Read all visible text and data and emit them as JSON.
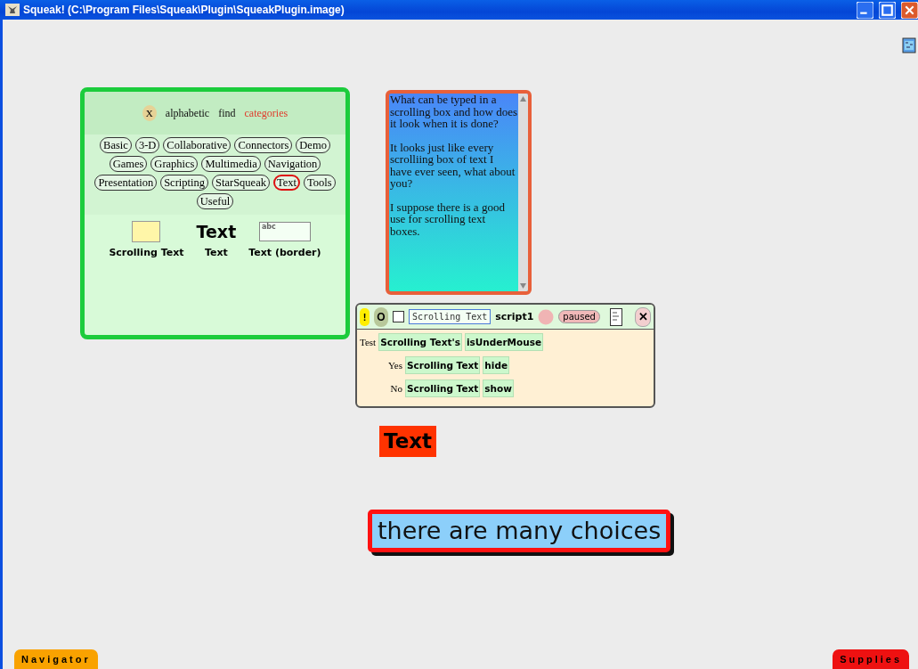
{
  "window": {
    "title": "Squeak! (C:\\Program Files\\Squeak\\Plugin\\SqueakPlugin.image)"
  },
  "parts_bin": {
    "close": "X",
    "tabs": [
      {
        "label": "alphabetic",
        "selected": false
      },
      {
        "label": "find",
        "selected": false
      },
      {
        "label": "categories",
        "selected": true
      }
    ],
    "categories": [
      {
        "label": "Basic",
        "selected": false
      },
      {
        "label": "3-D",
        "selected": false
      },
      {
        "label": "Collaborative",
        "selected": false
      },
      {
        "label": "Connectors",
        "selected": false
      },
      {
        "label": "Demo",
        "selected": false
      },
      {
        "label": "Games",
        "selected": false
      },
      {
        "label": "Graphics",
        "selected": false
      },
      {
        "label": "Multimedia",
        "selected": false
      },
      {
        "label": "Navigation",
        "selected": false
      },
      {
        "label": "Presentation",
        "selected": false
      },
      {
        "label": "Scripting",
        "selected": false
      },
      {
        "label": "StarSqueak",
        "selected": false
      },
      {
        "label": "Text",
        "selected": true
      },
      {
        "label": "Tools",
        "selected": false
      },
      {
        "label": "Useful",
        "selected": false
      }
    ],
    "items": [
      {
        "kind": "scrolling",
        "label": "Scrolling Text"
      },
      {
        "kind": "text",
        "sample": "Text",
        "label": "Text"
      },
      {
        "kind": "bordered",
        "sample": "abc",
        "label": "Text (border)"
      }
    ]
  },
  "scrolling_text": {
    "paragraphs": [
      "What can be typed in a scrolling box and how does it look when it is done?",
      "It looks just like every scrolliing box of text I have ever seen, what about you?",
      "I suppose there is a good use for scrolling text boxes."
    ]
  },
  "script": {
    "bang": "!",
    "ticker": "O",
    "checked": false,
    "object": "Scrolling Text",
    "name": "script1",
    "status": "paused",
    "close": "✕",
    "rows": [
      {
        "label": "Test",
        "tiles": [
          "Scrolling Text's",
          "isUnderMouse"
        ]
      },
      {
        "label": "Yes",
        "tiles": [
          "Scrolling Text",
          "hide"
        ]
      },
      {
        "label": "No",
        "tiles": [
          "Scrolling Text",
          "show"
        ]
      }
    ]
  },
  "text_morph": {
    "text": "Text"
  },
  "choices": {
    "text": "there are many choices"
  },
  "flaps": [
    {
      "label": "Navigator",
      "color": "#f9a200"
    },
    {
      "label": "Supplies",
      "color": "#ee1111"
    }
  ]
}
